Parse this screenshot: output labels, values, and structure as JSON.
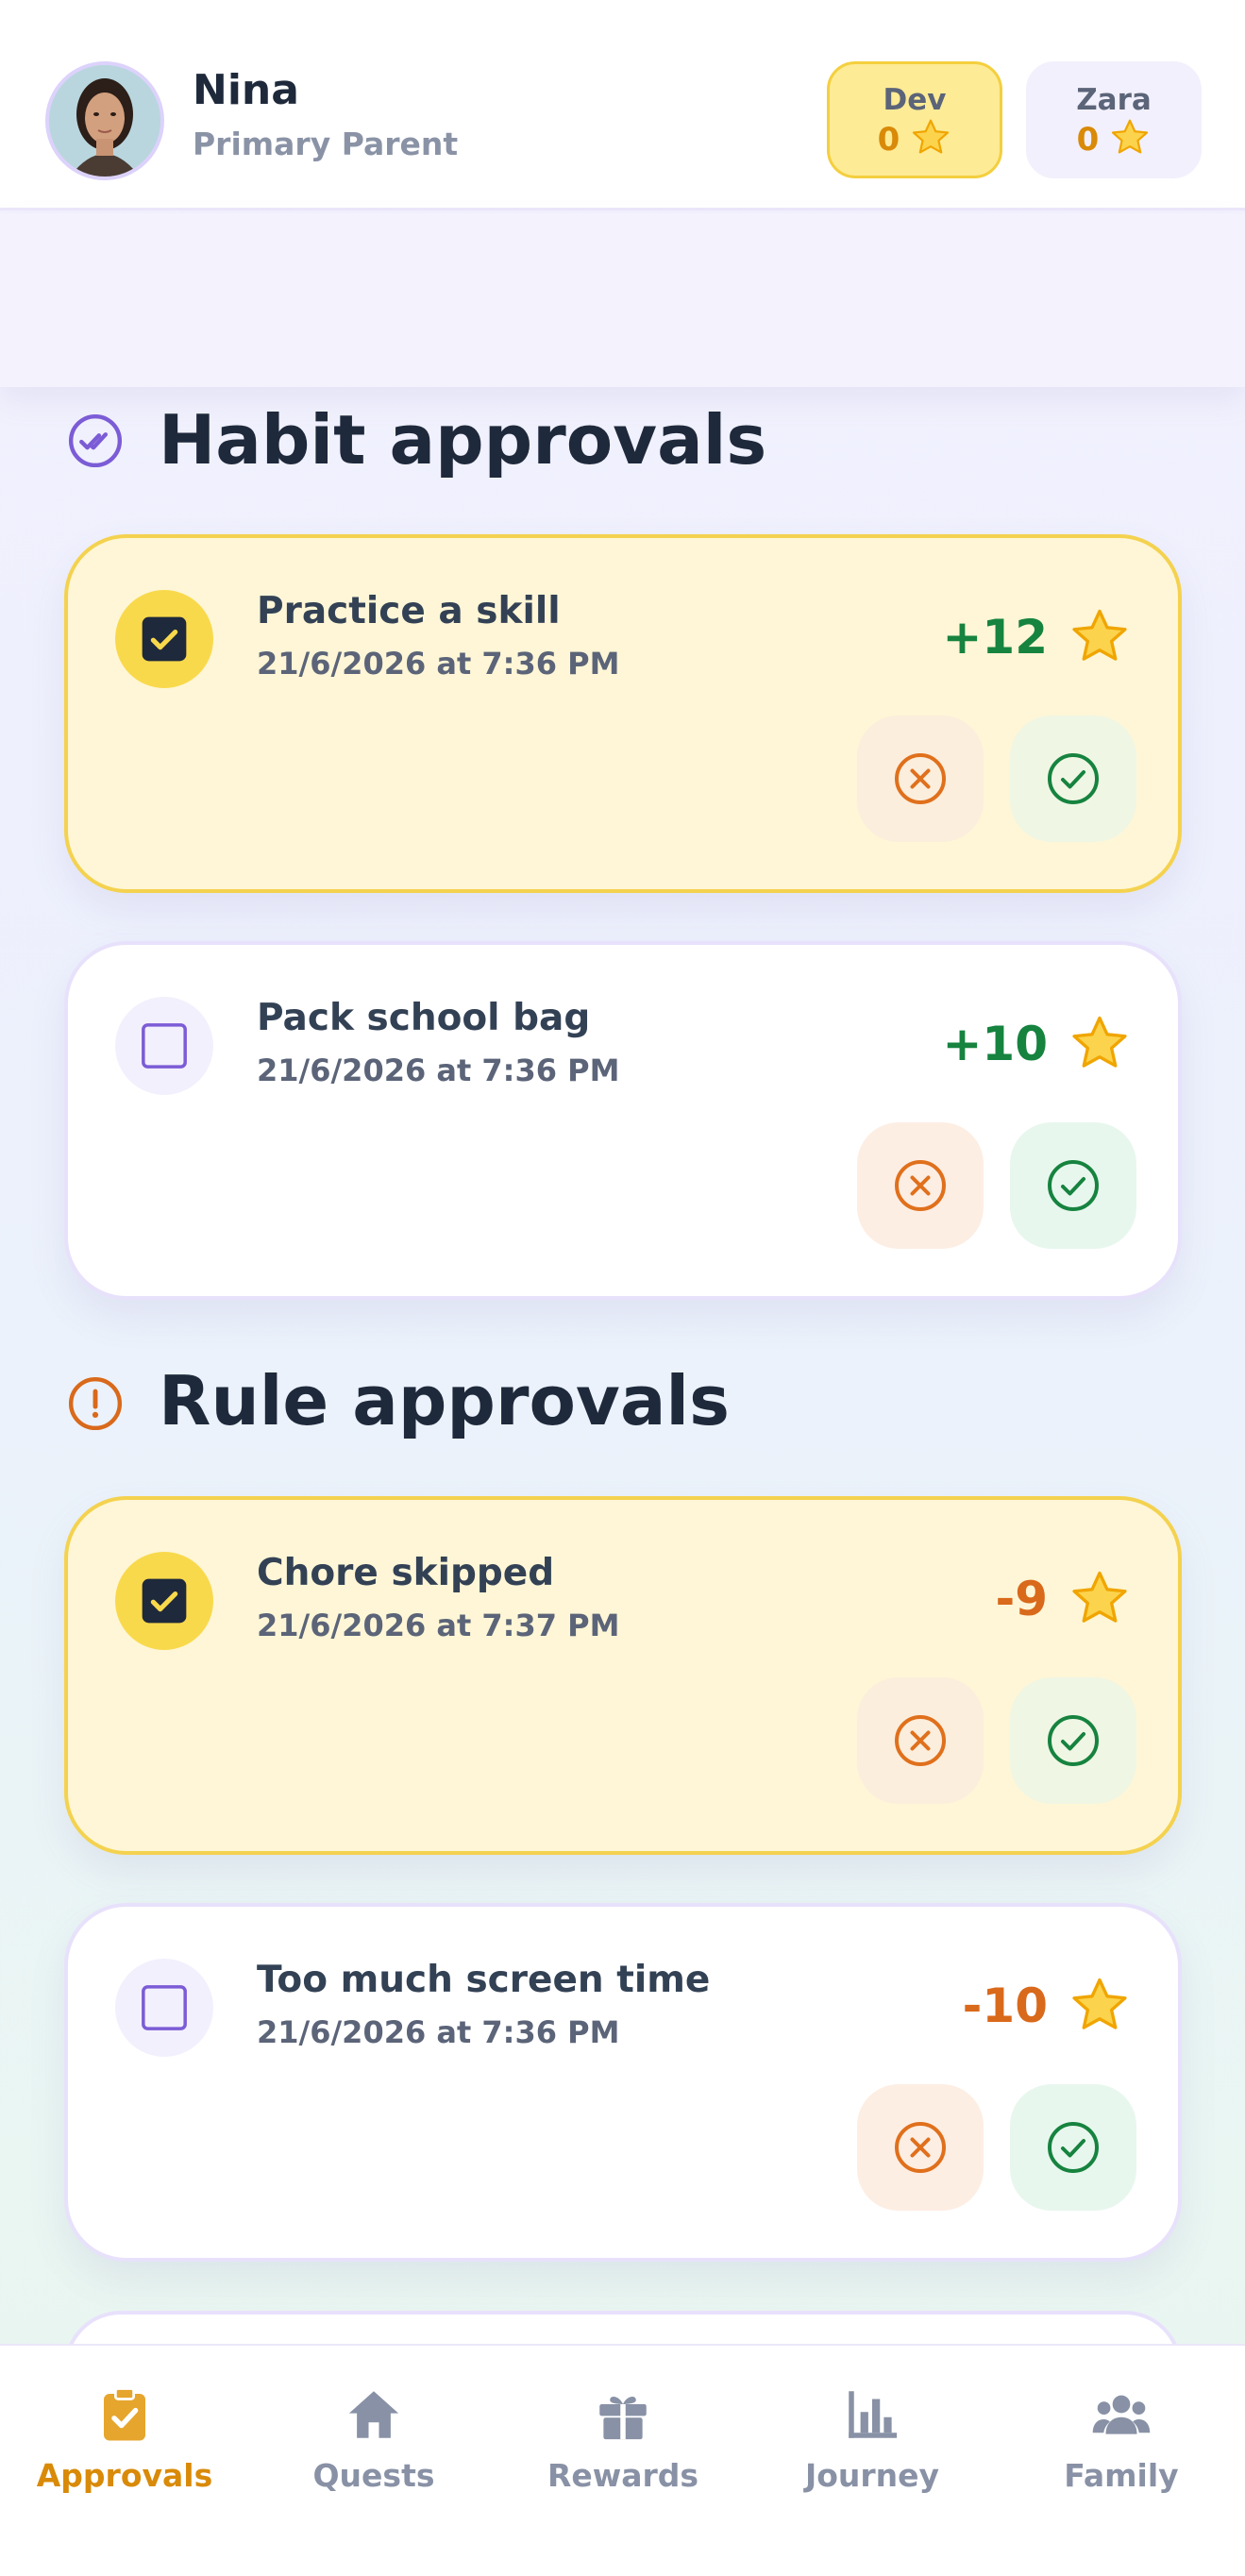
{
  "header": {
    "user_name": "Nina",
    "user_role": "Primary Parent",
    "children": [
      {
        "name": "Dev",
        "score": "0",
        "selected": true
      },
      {
        "name": "Zara",
        "score": "0",
        "selected": false
      }
    ]
  },
  "sections": {
    "habit": {
      "title": "Habit approvals",
      "icon": "double-check-circle-icon",
      "items": [
        {
          "title": "Practice a skill",
          "time": "21/6/2026 at 7:36 PM",
          "points": "+12",
          "selected": true
        },
        {
          "title": "Pack school bag",
          "time": "21/6/2026 at 7:36 PM",
          "points": "+10",
          "selected": false
        }
      ]
    },
    "rule": {
      "title": "Rule approvals",
      "icon": "alert-circle-icon",
      "items": [
        {
          "title": "Chore skipped",
          "time": "21/6/2026 at 7:37 PM",
          "points": "-9",
          "selected": true
        },
        {
          "title": "Too much screen time",
          "time": "21/6/2026 at 7:36 PM",
          "points": "-10",
          "selected": false
        }
      ]
    }
  },
  "nav": {
    "items": [
      {
        "label": "Approvals",
        "icon": "clipboard-check-icon",
        "active": true
      },
      {
        "label": "Quests",
        "icon": "home-icon",
        "active": false
      },
      {
        "label": "Rewards",
        "icon": "gift-icon",
        "active": false
      },
      {
        "label": "Journey",
        "icon": "bar-chart-icon",
        "active": false
      },
      {
        "label": "Family",
        "icon": "people-icon",
        "active": false
      }
    ]
  },
  "colors": {
    "accent": "#d98a08",
    "positive": "#16833f",
    "negative": "#d9691b",
    "selected_card": "#fef6d6",
    "selected_border": "#f4d24f",
    "purple": "#7c5cd6"
  }
}
